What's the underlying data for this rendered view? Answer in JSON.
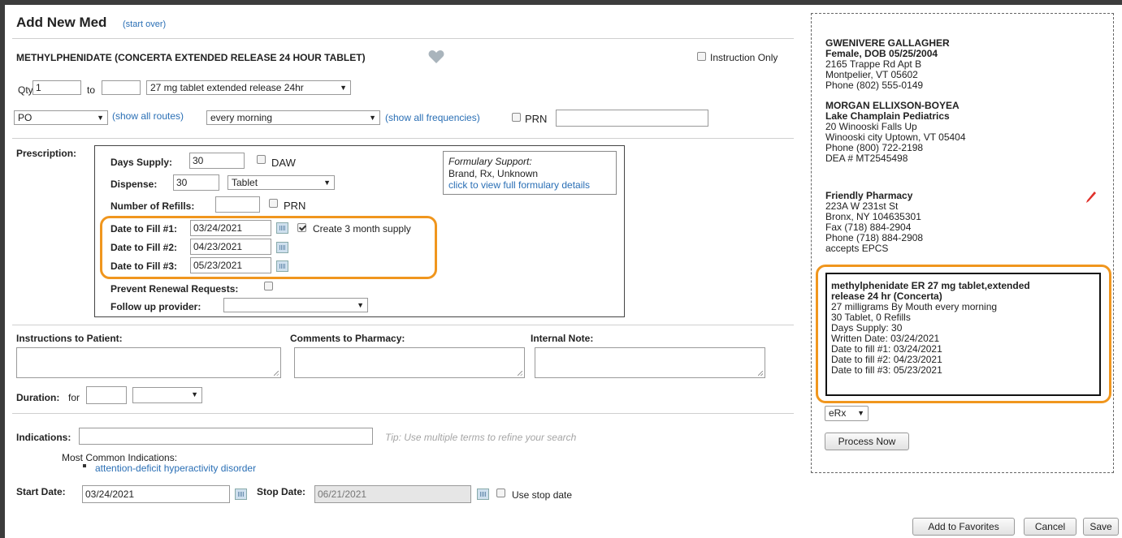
{
  "header": {
    "title": "Add New Med",
    "start_over": "(start over)",
    "drug_name": "METHYLPHENIDATE (CONCERTA EXTENDED RELEASE 24 HOUR TABLET)",
    "instruction_only": "Instruction Only"
  },
  "dose": {
    "qty_label": "Qty:",
    "qty_value": "1",
    "to_label": "to",
    "to_value": "",
    "form": "27 mg tablet extended release 24hr",
    "route": "PO",
    "show_routes": "(show all routes)",
    "frequency": "every morning",
    "show_frequencies": "(show all frequencies)",
    "prn": "PRN",
    "prn_text": ""
  },
  "prescription": {
    "label": "Prescription:",
    "days_supply_label": "Days Supply:",
    "days_supply": "30",
    "daw": "DAW",
    "dispense_label": "Dispense:",
    "dispense": "30",
    "dispense_unit": "Tablet",
    "refills_label": "Number of Refills:",
    "refills": "",
    "refills_prn": "PRN",
    "fill1_label": "Date to Fill #1:",
    "fill1": "03/24/2021",
    "fill2_label": "Date to Fill #2:",
    "fill2": "04/23/2021",
    "fill3_label": "Date to Fill #3:",
    "fill3": "05/23/2021",
    "create_supply": "Create 3 month supply",
    "create_supply_checked": true,
    "prevent_renewal": "Prevent Renewal Requests:",
    "follow_up": "Follow up provider:",
    "follow_up_value": "",
    "formulary_title": "Formulary Support:",
    "formulary_types": "Brand, Rx, Unknown",
    "formulary_link": "click to view full formulary details"
  },
  "notes": {
    "instructions_label": "Instructions to Patient:",
    "comments_label": "Comments to Pharmacy:",
    "internal_label": "Internal Note:",
    "duration_label": "Duration:",
    "duration_for": "for",
    "duration_value": ""
  },
  "indications": {
    "label": "Indications:",
    "tip": "Tip: Use multiple terms to refine your search",
    "common_label": "Most Common Indications:",
    "common_item": "attention-deficit hyperactivity disorder",
    "start_label": "Start Date:",
    "start_date": "03/24/2021",
    "stop_label": "Stop Date:",
    "stop_date": "06/21/2021",
    "use_stop": "Use stop date"
  },
  "sidebar": {
    "patient_name": "GWENIVERE GALLAGHER",
    "patient_info": "Female, DOB 05/25/2004",
    "patient_addr1": "2165 Trappe Rd Apt B",
    "patient_addr2": "Montpelier, VT 05602",
    "patient_phone": "Phone (802) 555-0149",
    "prescriber_name": "MORGAN ELLIXSON-BOYEA",
    "prescriber_org": "Lake Champlain Pediatrics",
    "prescriber_addr1": "20 Winooski Falls Up",
    "prescriber_addr2": "Winooski city Uptown, VT 05404",
    "prescriber_phone": "Phone (800) 722-2198",
    "prescriber_dea": "DEA # MT2545498",
    "pharmacy_name": "Friendly Pharmacy",
    "pharmacy_addr1": "223A W 231st St",
    "pharmacy_addr2": "Bronx, NY 104635301",
    "pharmacy_fax": "Fax (718) 884-2904",
    "pharmacy_phone": "Phone (718) 884-2908",
    "pharmacy_epcs": "accepts EPCS",
    "summary_title1": "methylphenidate ER 27 mg tablet,extended",
    "summary_title2": "release 24 hr (Concerta)",
    "summary_sig": "27 milligrams By Mouth every morning",
    "summary_qty": "30 Tablet, 0 Refills",
    "summary_days": "Days Supply: 30",
    "summary_written": "Written Date: 03/24/2021",
    "summary_fill1": "Date to fill #1: 03/24/2021",
    "summary_fill2": "Date to fill #2: 04/23/2021",
    "summary_fill3": "Date to fill #3: 05/23/2021",
    "send_method": "eRx",
    "process_now": "Process Now"
  },
  "footer": {
    "add_favorites": "Add to Favorites",
    "cancel": "Cancel",
    "save": "Save"
  },
  "colors": {
    "link": "#2a6fb5",
    "highlight": "#f0961e",
    "edit_icon": "#e0302a"
  }
}
